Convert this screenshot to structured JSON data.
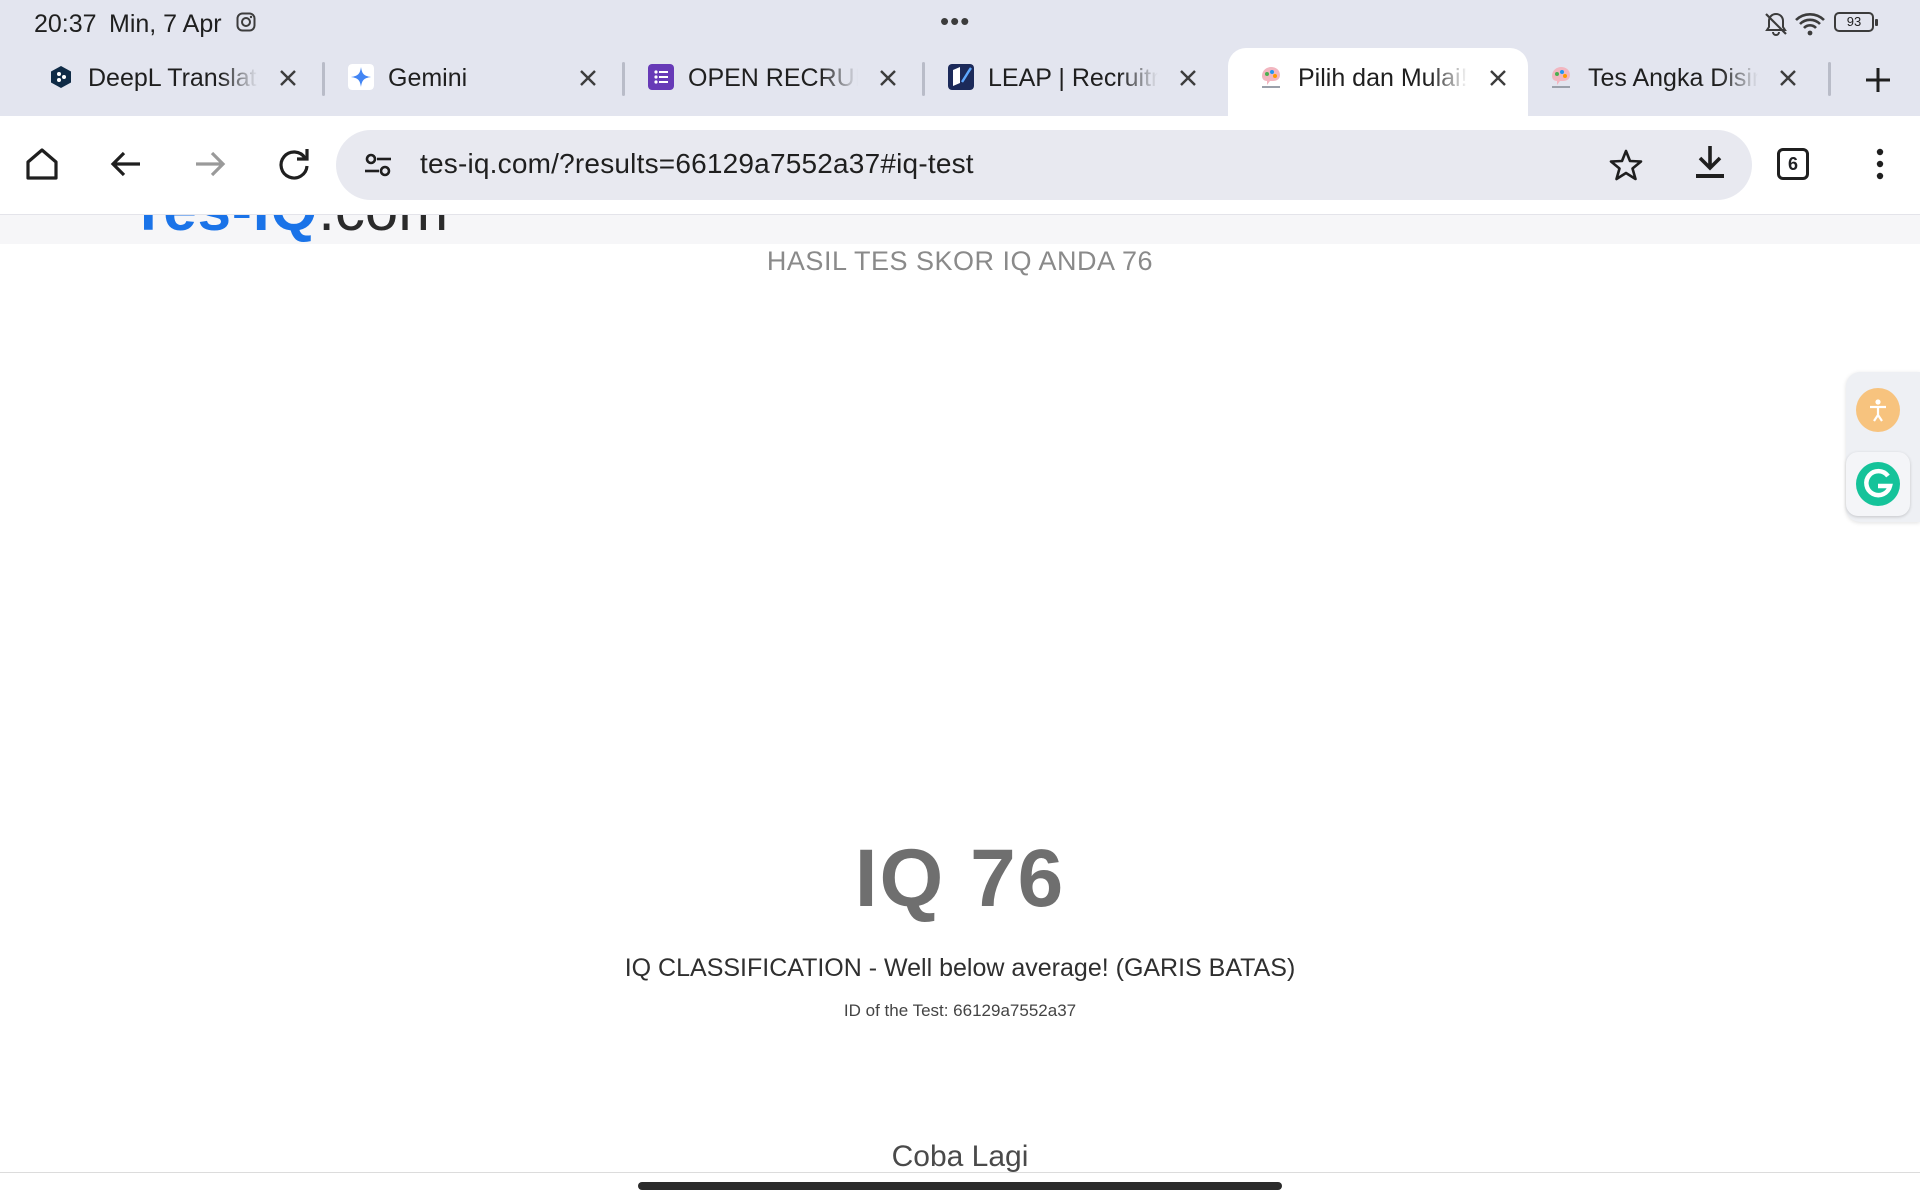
{
  "status_bar": {
    "time": "20:37",
    "date": "Min, 7 Apr",
    "more_dots": "•••",
    "battery_level": "93"
  },
  "tabs": [
    {
      "title": "DeepL Translate: I",
      "favicon": "deepl-icon",
      "color": "#0f2b46"
    },
    {
      "title": "Gemini",
      "favicon": "gemini-icon",
      "color": "#4285f4"
    },
    {
      "title": "OPEN RECRUITMENT",
      "favicon": "forms-icon",
      "color": "#673ab7"
    },
    {
      "title": "LEAP | Recruitment",
      "favicon": "leap-icon",
      "color": "#1c2a5a"
    },
    {
      "title": "Pilih dan Mulai! Te",
      "favicon": "tes-iq-icon",
      "color": "#e86f5a",
      "active": true
    },
    {
      "title": "Tes Angka Disini!",
      "favicon": "tes-iq-icon",
      "color": "#e86f5a"
    }
  ],
  "toolbar": {
    "url": "tes-iq.com/?results=66129a7552a37#iq-test",
    "tab_count": "6"
  },
  "page": {
    "logo_main": "Tes-IQ",
    "logo_tld": ".com",
    "result_heading": "HASIL TES SKOR IQ ANDA 76",
    "iq_score": "IQ 76",
    "classification": "IQ CLASSIFICATION - Well below average! (GARIS BATAS)",
    "test_id": "ID of the Test: 66129a7552a37",
    "retry_label": "Coba Lagi"
  },
  "colors": {
    "chrome_bg": "#e3e5ef",
    "omnibox_bg": "#e8e9f0",
    "logo_blue": "#1a73e8",
    "score_gray": "#6f6f6f",
    "accessibility_orange": "#f7c37e",
    "grammarly_green": "#15c39a"
  }
}
